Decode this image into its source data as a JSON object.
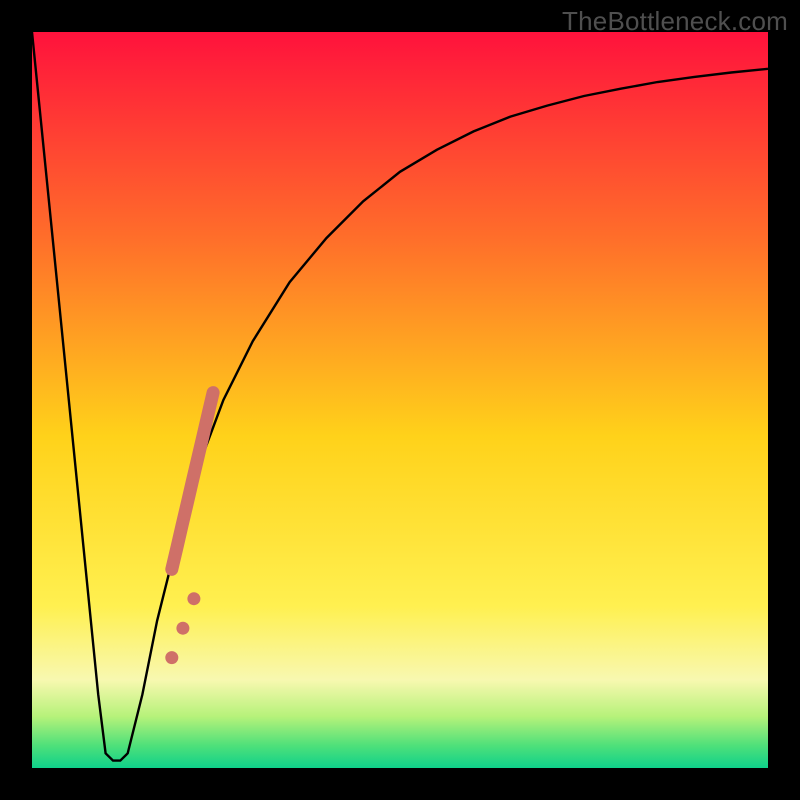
{
  "watermark": "TheBottleneck.com",
  "colors": {
    "frame": "#000000",
    "curve": "#000000",
    "markers": "#cf7068",
    "gradient_top": "#ff123c",
    "gradient_mid_upper": "#ff6e2a",
    "gradient_mid": "#ffd21a",
    "gradient_mid_lower": "#fff050",
    "gradient_band_light": "#f8f8b0",
    "gradient_green1": "#b6f27a",
    "gradient_green2": "#4de07a",
    "gradient_green3": "#0fd18a"
  },
  "chart_data": {
    "type": "line",
    "title": "",
    "xlabel": "",
    "ylabel": "",
    "xlim": [
      0,
      100
    ],
    "ylim": [
      0,
      100
    ],
    "series": [
      {
        "name": "curve",
        "x": [
          0,
          3,
          5,
          7,
          9,
          10,
          11,
          12,
          13,
          15,
          17,
          20,
          23,
          26,
          30,
          35,
          40,
          45,
          50,
          55,
          60,
          65,
          70,
          75,
          80,
          85,
          90,
          95,
          100
        ],
        "y": [
          100,
          70,
          50,
          30,
          10,
          2,
          1,
          1,
          2,
          10,
          20,
          32,
          42,
          50,
          58,
          66,
          72,
          77,
          81,
          84,
          86.5,
          88.5,
          90,
          91.3,
          92.3,
          93.2,
          93.9,
          94.5,
          95
        ]
      }
    ],
    "markers": {
      "name": "highlight-segment",
      "type": "scatter",
      "color": "#cf7068",
      "points": [
        {
          "x": 19.0,
          "y": 27.0
        },
        {
          "x": 19.7,
          "y": 30.0
        },
        {
          "x": 20.4,
          "y": 33.0
        },
        {
          "x": 21.1,
          "y": 36.0
        },
        {
          "x": 21.8,
          "y": 39.0
        },
        {
          "x": 22.5,
          "y": 42.0
        },
        {
          "x": 23.2,
          "y": 45.0
        },
        {
          "x": 23.9,
          "y": 48.0
        },
        {
          "x": 24.6,
          "y": 51.0
        },
        {
          "x": 22.0,
          "y": 23.0
        },
        {
          "x": 20.5,
          "y": 19.0
        },
        {
          "x": 19.0,
          "y": 15.0
        }
      ]
    }
  }
}
